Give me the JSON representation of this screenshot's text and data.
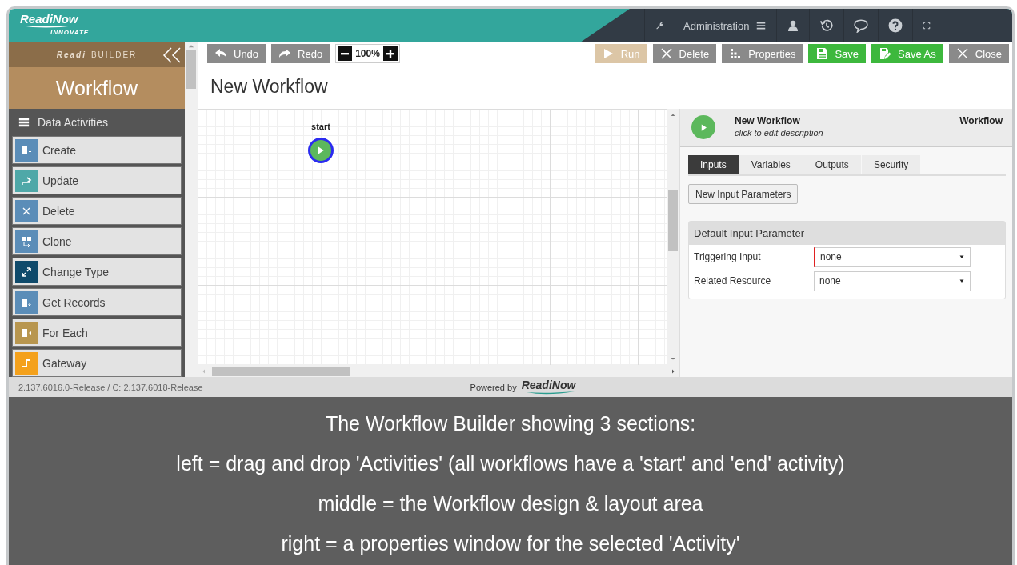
{
  "header": {
    "logo": {
      "name": "ReadiNow",
      "tagline": "INNOVATE"
    },
    "admin_label": "Administration"
  },
  "sidebar": {
    "brand": {
      "prefix": "Readi",
      "suffix": "BUILDER"
    },
    "title": "Workflow",
    "group": "Data Activities",
    "items": [
      {
        "label": "Create",
        "color": "#5b8db8"
      },
      {
        "label": "Update",
        "color": "#4fa8a8"
      },
      {
        "label": "Delete",
        "color": "#5b8db8"
      },
      {
        "label": "Clone",
        "color": "#5b8db8"
      },
      {
        "label": "Change Type",
        "color": "#0f4a6b"
      },
      {
        "label": "Get Records",
        "color": "#5b8db8"
      },
      {
        "label": "For Each",
        "color": "#b8964f"
      },
      {
        "label": "Gateway",
        "color": "#f4a11c"
      }
    ]
  },
  "toolbar": {
    "left": [
      {
        "label": "Undo",
        "kind": "undo"
      },
      {
        "label": "Redo",
        "kind": "redo"
      }
    ],
    "zoom": "100%",
    "right": [
      {
        "label": "Run",
        "kind": "run",
        "disabled": true
      },
      {
        "label": "Delete",
        "kind": "delete",
        "disabled": false
      },
      {
        "label": "Properties",
        "kind": "properties",
        "disabled": false
      },
      {
        "label": "Save",
        "kind": "save",
        "disabled": false
      },
      {
        "label": "Save As",
        "kind": "save_as",
        "disabled": false
      },
      {
        "label": "Close",
        "kind": "close",
        "disabled": false
      }
    ]
  },
  "page_title": "New Workflow",
  "canvas": {
    "nodes": [
      {
        "label": "start",
        "selected": true
      }
    ]
  },
  "properties": {
    "title": "New Workflow",
    "description": "click to edit description",
    "type": "Workflow",
    "tabs": [
      {
        "label": "Inputs",
        "selected": true
      },
      {
        "label": "Variables",
        "selected": false
      },
      {
        "label": "Outputs",
        "selected": false
      },
      {
        "label": "Security",
        "selected": false
      }
    ],
    "new_button": "New Input Parameters",
    "section": "Default Input Parameter",
    "fields": [
      {
        "label": "Triggering Input",
        "value": "none",
        "required": true
      },
      {
        "label": "Related Resource",
        "value": "none",
        "required": false
      }
    ]
  },
  "footer": {
    "version": "2.137.6016.0-Release / C: 2.137.6018-Release",
    "powered_by": "Powered by",
    "logo": "ReadiNow"
  },
  "caption": [
    "The Workflow Builder showing 3 sections:",
    "left = drag and drop 'Activities' (all workflows have a 'start' and 'end' activity)",
    "middle = the Workflow design & layout area",
    "right = a properties window for the selected 'Activity'"
  ]
}
